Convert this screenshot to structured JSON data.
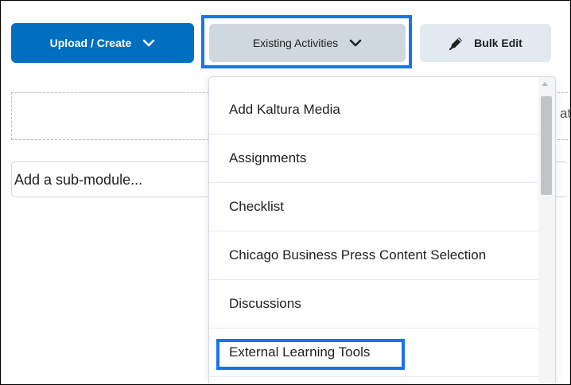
{
  "toolbar": {
    "upload_create_label": "Upload / Create",
    "existing_activities_label": "Existing Activities",
    "bulk_edit_label": "Bulk Edit"
  },
  "content": {
    "dropzone_tail_text": "ate",
    "add_submodule_placeholder": "Add a sub-module..."
  },
  "menu": {
    "items": [
      {
        "label": "Add Kaltura Media"
      },
      {
        "label": "Assignments"
      },
      {
        "label": "Checklist"
      },
      {
        "label": "Chicago Business Press Content Selection"
      },
      {
        "label": "Discussions"
      },
      {
        "label": "External Learning Tools"
      }
    ],
    "highlighted_item": "External Learning Tools"
  },
  "colors": {
    "primary_button": "#006fbf",
    "existing_button": "#cfd8de",
    "bulk_button": "#e3e9f1",
    "highlight_outline": "#1a73e8"
  },
  "icons": {
    "upload_chevron": "chevron-down-icon",
    "existing_chevron": "chevron-down-icon",
    "bulk_edit": "pencil-icon"
  }
}
